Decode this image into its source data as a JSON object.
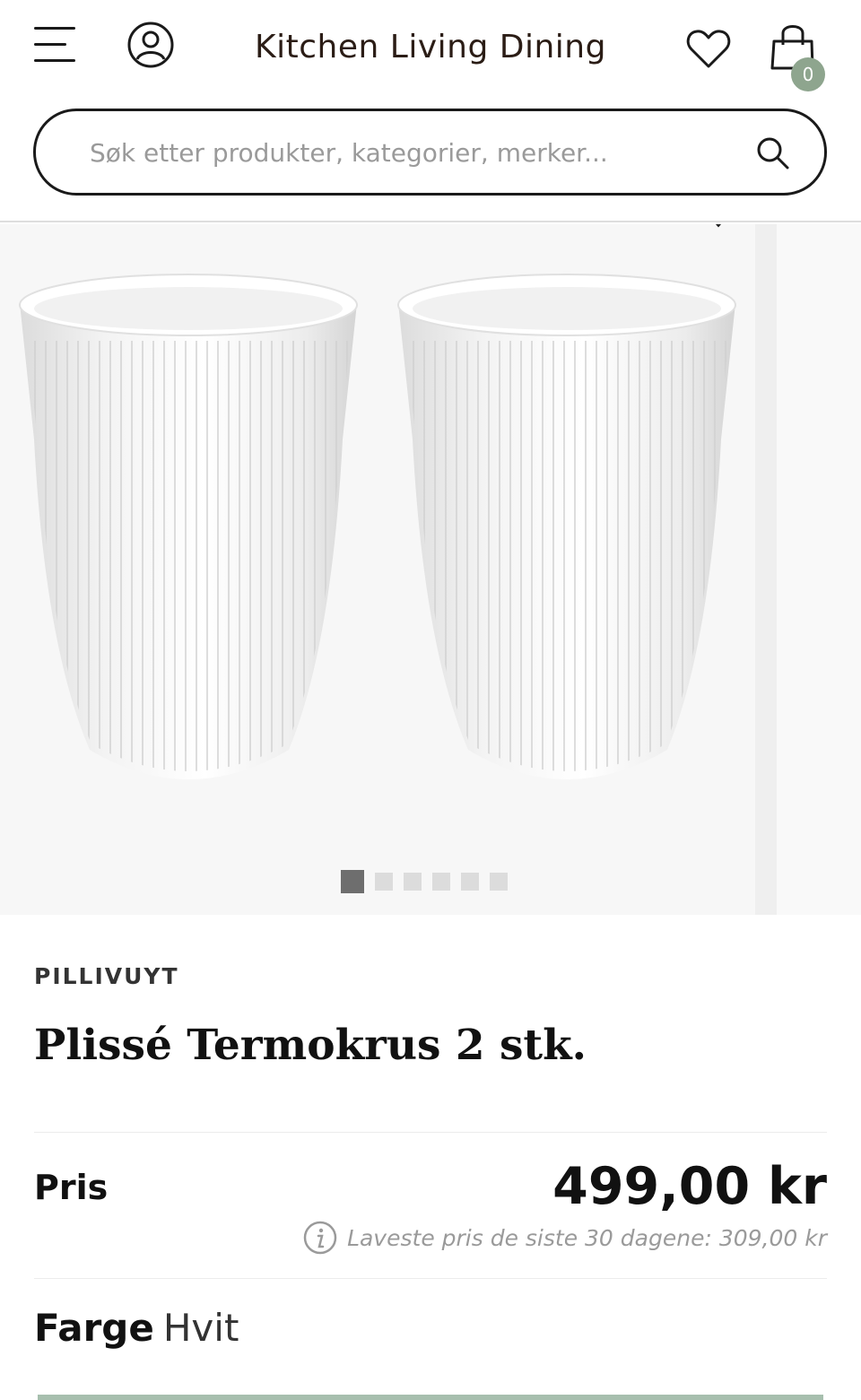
{
  "header": {
    "logo": "Kitchen Living Dining",
    "cart_count": "0",
    "menu_icon": "hamburger-menu-icon",
    "account_icon": "user-account-icon",
    "wishlist_icon": "heart-icon",
    "cart_icon": "shopping-bag-icon"
  },
  "search": {
    "placeholder": "Søk etter produkter, kategorier, merker...",
    "value": "",
    "icon": "search-icon"
  },
  "gallery": {
    "image_count": 6,
    "active_index": 0
  },
  "product": {
    "brand": "PILLIVUYT",
    "title": "Plissé Termokrus 2 stk.",
    "price_label": "Pris",
    "price": "499,00 kr",
    "lowest_price_note": "Laveste pris de siste 30 dagene: 309,00 kr",
    "color_label": "Farge",
    "color_value": "Hvit"
  },
  "colors": {
    "cart_badge": "#8ea58e",
    "accent_bar": "#a7bfae",
    "logo_text": "#2b1d16"
  }
}
